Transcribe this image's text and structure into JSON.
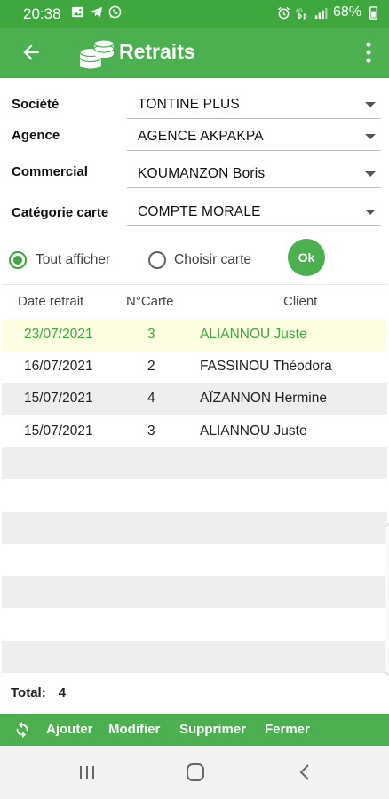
{
  "status_bar": {
    "time": "20:38",
    "battery": "68%",
    "left_icons": [
      "image-icon",
      "telegram-icon",
      "whatsapp-icon"
    ],
    "right_icons": [
      "alarm-icon",
      "signal-4g-icon",
      "signal-bars-icon",
      "battery-icon"
    ]
  },
  "app_bar": {
    "title": "Retraits",
    "icons": [
      "back-arrow-icon",
      "coins-icon",
      "overflow-menu-icon"
    ]
  },
  "form": {
    "societe": {
      "label": "Société",
      "value": "TONTINE PLUS"
    },
    "agence": {
      "label": "Agence",
      "value": "AGENCE AKPAKPA"
    },
    "commercial": {
      "label": "Commercial",
      "value": "KOUMANZON Boris"
    },
    "categorie": {
      "label": "Catégorie carte",
      "value": "COMPTE MORALE"
    }
  },
  "filter": {
    "all_label": "Tout afficher",
    "choose_label": "Choisir carte",
    "selected": "all",
    "ok_label": "Ok"
  },
  "table": {
    "headers": [
      "Date retrait",
      "N°Carte",
      "Client"
    ],
    "rows": [
      {
        "date": "23/07/2021",
        "card": "3",
        "client": "ALIANNOU Juste",
        "selected": true
      },
      {
        "date": "16/07/2021",
        "card": "2",
        "client": "FASSINOU Théodora",
        "selected": false
      },
      {
        "date": "15/07/2021",
        "card": "4",
        "client": "AÏZANNON Hermine",
        "selected": false
      },
      {
        "date": "15/07/2021",
        "card": "3",
        "client": "ALIANNOU Juste",
        "selected": false
      }
    ]
  },
  "total": {
    "label": "Total:",
    "value": "4"
  },
  "actions": {
    "refresh_icon": "refresh-icon",
    "add": "Ajouter",
    "edit": "Modifier",
    "delete": "Supprimer",
    "close": "Fermer"
  },
  "nav_bar": {
    "icons": [
      "recent-apps-icon",
      "home-icon",
      "back-icon"
    ]
  },
  "colors": {
    "primary": "#4caf50",
    "status_bar": "#3ea83e",
    "selected_text": "#3ea83e",
    "selected_row_bg": "#fdfde2",
    "stripe": "#eeeeee"
  }
}
